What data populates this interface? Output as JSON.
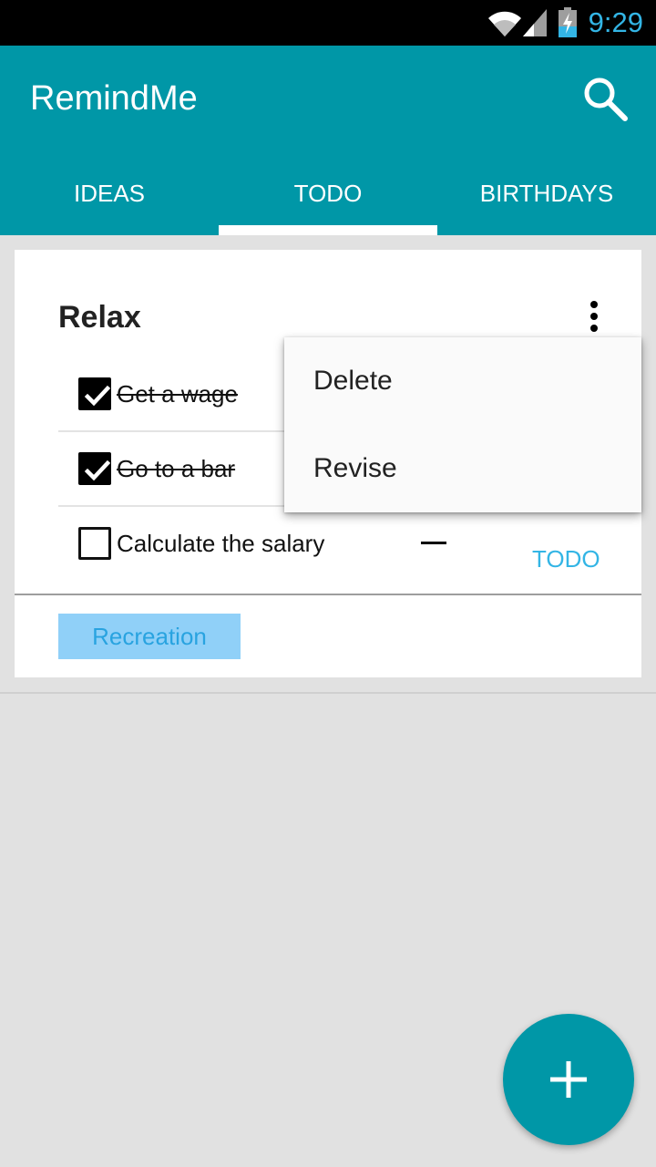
{
  "status_bar": {
    "time": "9:29",
    "icons": [
      "wifi-icon",
      "signal-icon",
      "battery-charging-icon"
    ],
    "time_color": "#33b5e5"
  },
  "app_bar": {
    "title": "RemindMe",
    "search_icon": "search-icon",
    "background": "#0097a7"
  },
  "tabs": [
    {
      "label": "IDEAS",
      "selected": false
    },
    {
      "label": "TODO",
      "selected": true
    },
    {
      "label": "BIRTHDAYS",
      "selected": false
    }
  ],
  "card": {
    "title": "Relax",
    "overflow_icon": "more-vert-icon",
    "items": [
      {
        "label": "Get a wage",
        "checked": true
      },
      {
        "label": "Go to a bar",
        "checked": true
      },
      {
        "label": "Calculate the salary",
        "checked": false
      }
    ],
    "status": "TODO",
    "tag": "Recreation"
  },
  "popup_menu": {
    "items": [
      "Delete",
      "Revise"
    ]
  },
  "fab": {
    "icon": "plus-icon"
  },
  "colors": {
    "primary": "#0097a7",
    "accent": "#33b5e5",
    "tag_background": "#90d0f8",
    "background": "#e1e1e1"
  }
}
